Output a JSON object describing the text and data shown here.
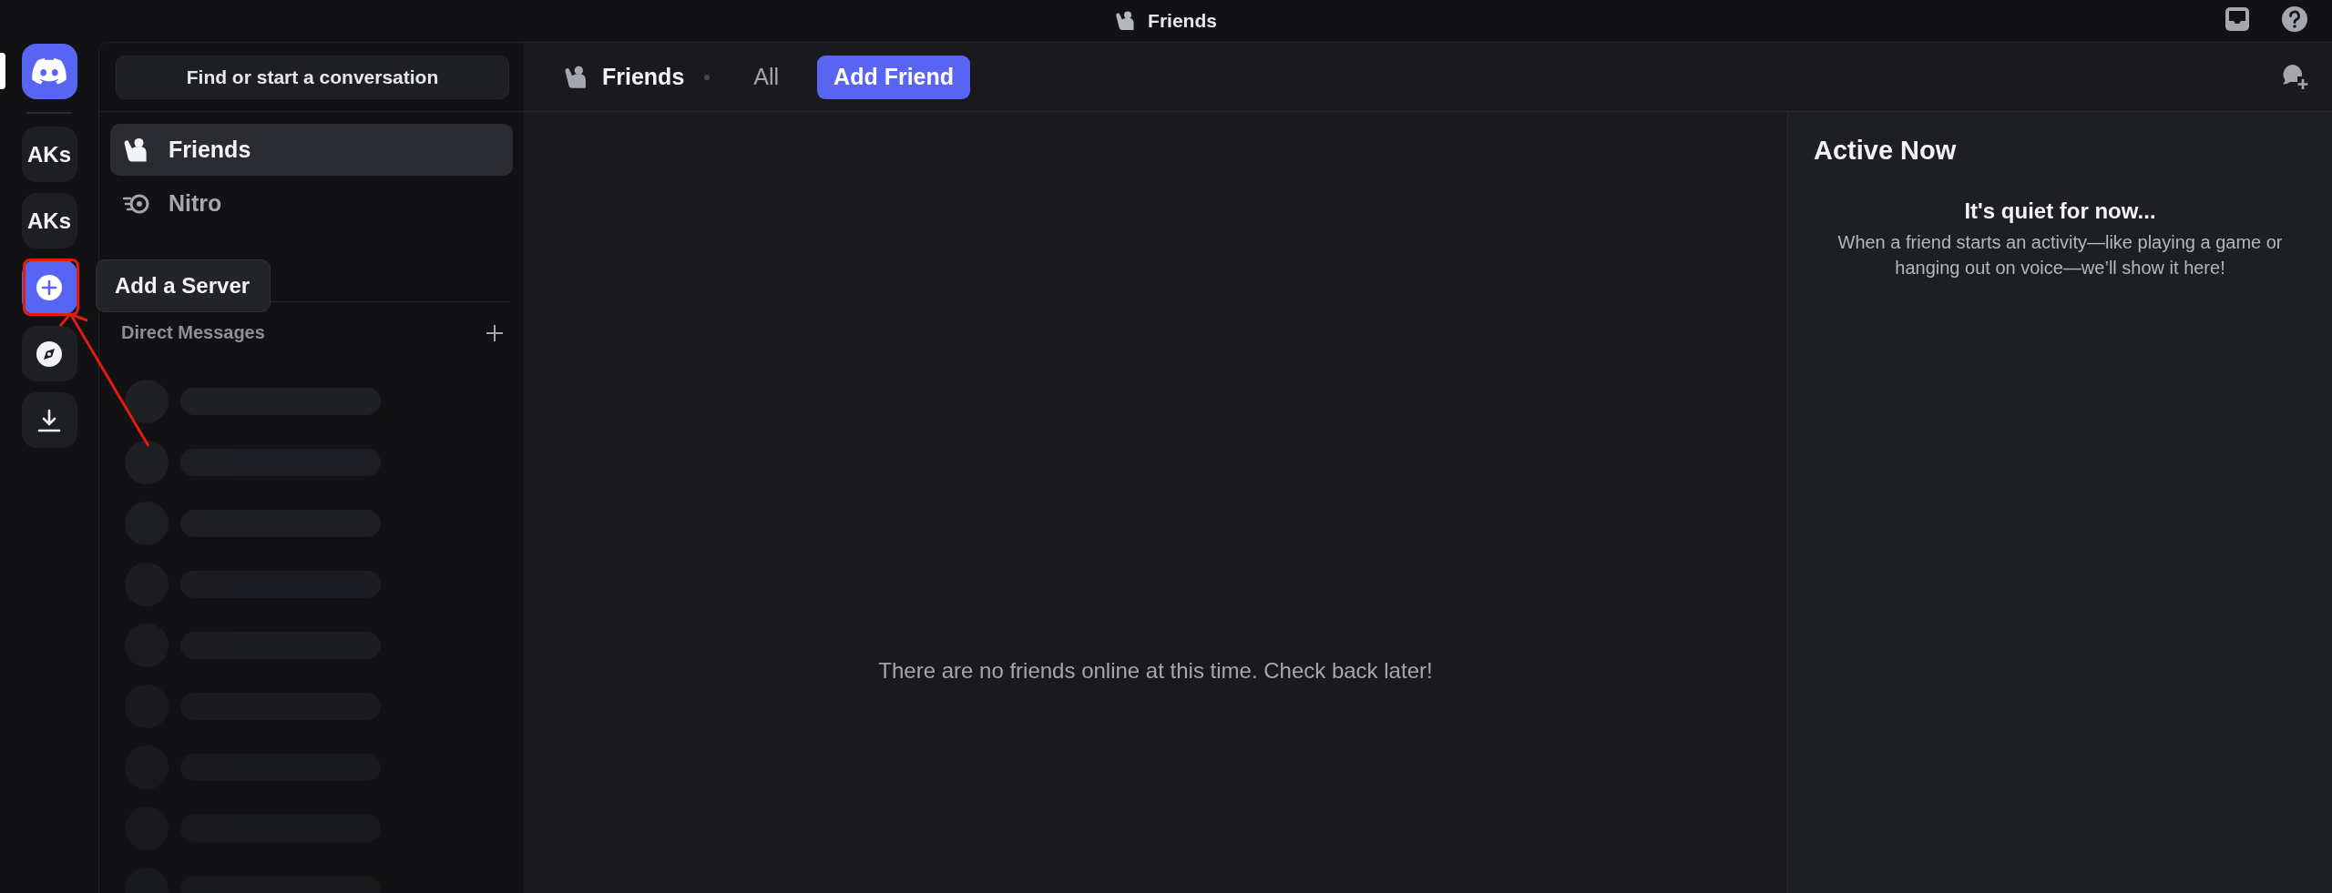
{
  "title_bar": {
    "title": "Friends"
  },
  "servers": [
    {
      "kind": "home",
      "selected": true
    },
    {
      "kind": "text",
      "label": "AKs",
      "selected": false
    },
    {
      "kind": "text",
      "label": "AKs",
      "selected": false
    },
    {
      "kind": "add",
      "selected": false,
      "tooltip": "Add a Server"
    },
    {
      "kind": "explore",
      "selected": false
    },
    {
      "kind": "download",
      "selected": false
    }
  ],
  "search": {
    "label": "Find or start a conversation"
  },
  "nav": [
    {
      "kind": "friends",
      "label": "Friends",
      "selected": true
    },
    {
      "kind": "nitro",
      "label": "Nitro",
      "selected": false
    }
  ],
  "direct_messages": {
    "title": "Direct Messages"
  },
  "header": {
    "title": "Friends",
    "tabs": [
      {
        "kind": "tab",
        "label": "All",
        "selected": false
      },
      {
        "kind": "button",
        "label": "Add Friend",
        "selected": true
      }
    ]
  },
  "main": {
    "empty_text": "There are no friends online at this time. Check back later!"
  },
  "active_now": {
    "title": "Active Now",
    "empty_title": "It's quiet for now...",
    "empty_text": "When a friend starts an activity—like playing a game or hanging out on voice—we’ll show it here!"
  }
}
